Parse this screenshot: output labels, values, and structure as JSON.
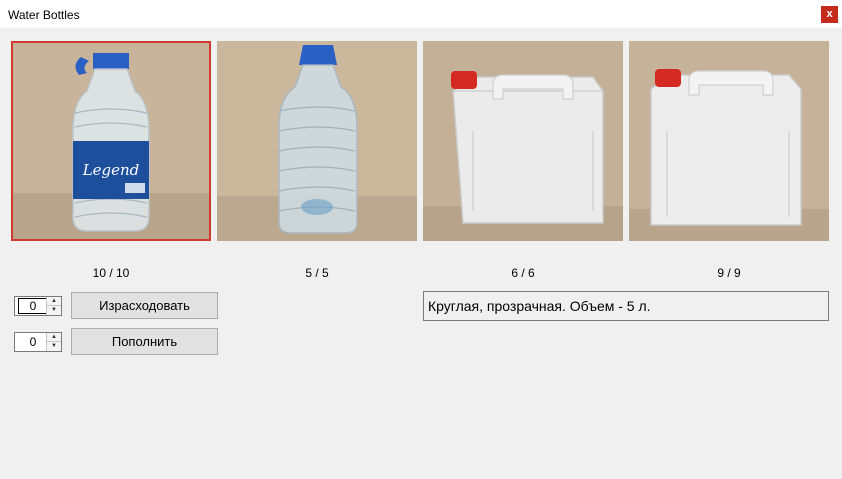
{
  "window": {
    "title": "Water Bottles",
    "close_label": "x"
  },
  "bottles": [
    {
      "count": "10 / 10",
      "brand_text": "Legend",
      "selected": true
    },
    {
      "count": "5 / 5",
      "selected": false
    },
    {
      "count": "6 / 6",
      "selected": false
    },
    {
      "count": "9 / 9",
      "selected": false
    }
  ],
  "consume": {
    "value": "0",
    "button_label": "Израсходовать"
  },
  "refill": {
    "value": "0",
    "button_label": "Пополнить"
  },
  "description": "Круглая, прозрачная. Объем - 5 л.",
  "colors": {
    "selection_border": "#d13b2f",
    "close_button": "#c42b1c",
    "cap_blue": "#2a5fc4",
    "cap_red": "#d52a24"
  }
}
